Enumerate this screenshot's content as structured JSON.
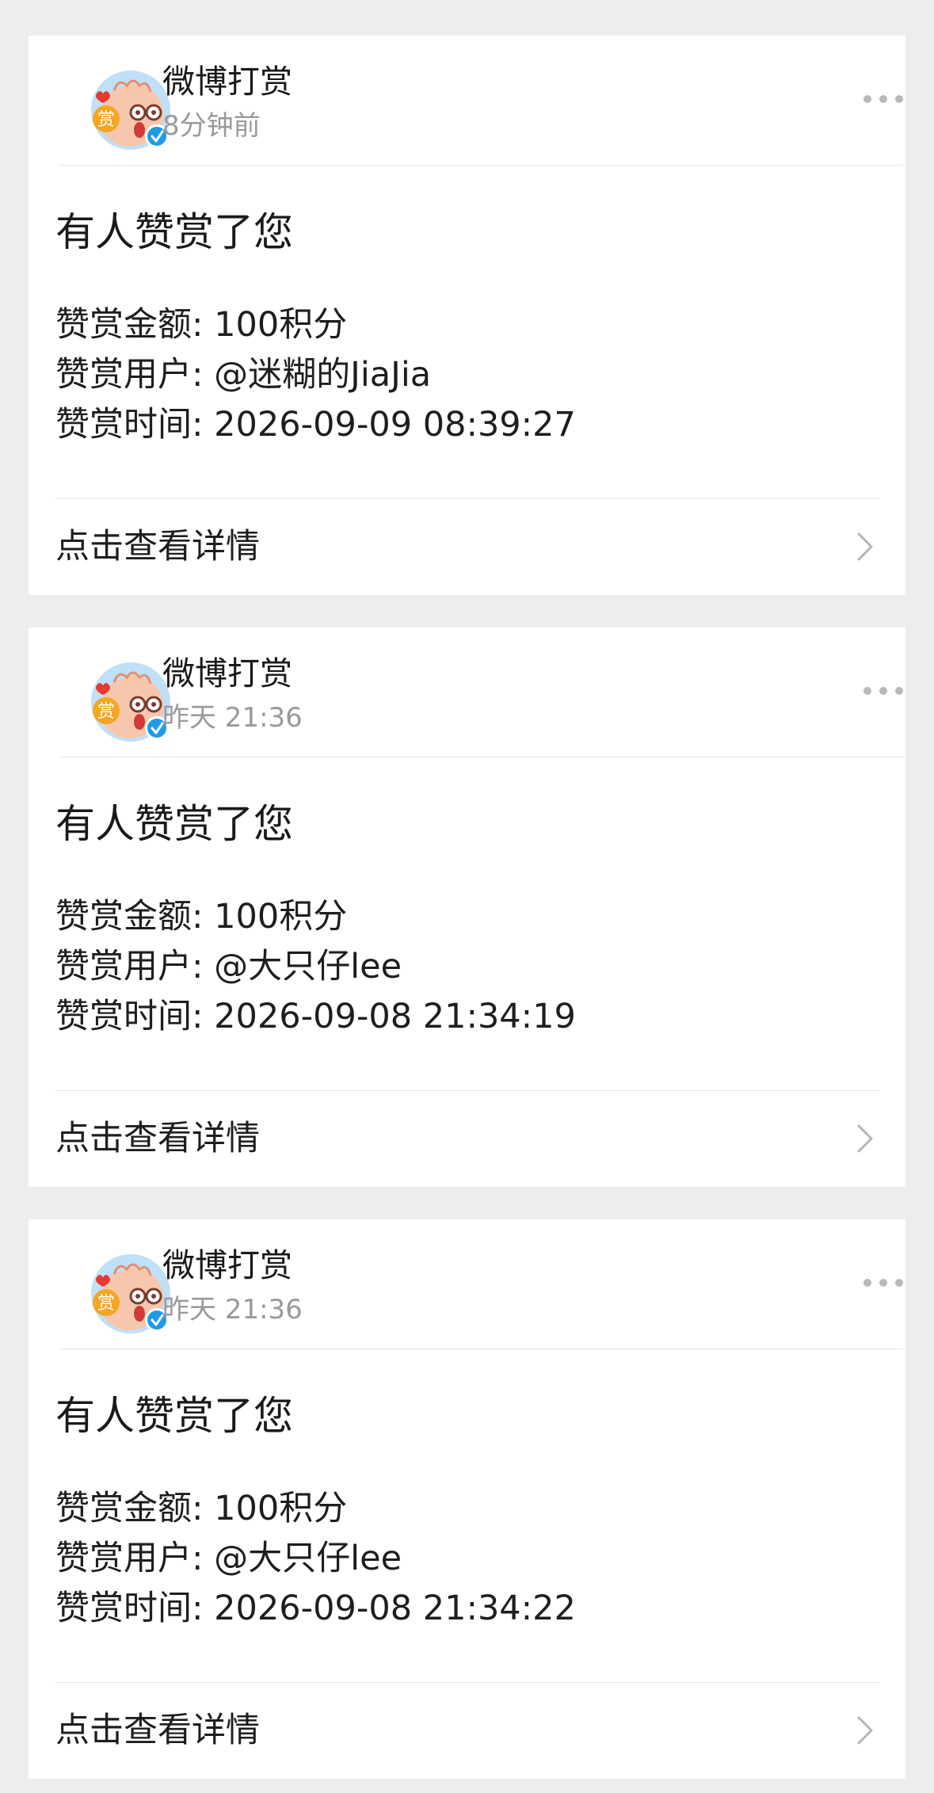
{
  "notifications": [
    {
      "sender": "微博打赏",
      "time": "8分钟前",
      "title": "有人赞赏了您",
      "amount_label": "赞赏金额:",
      "amount_value": "100积分",
      "user_label": "赞赏用户:",
      "user_value": "@迷糊的JiaJia",
      "time_label": "赞赏时间:",
      "time_value": "2026-09-09 08:39:27",
      "detail_label": "点击查看详情"
    },
    {
      "sender": "微博打赏",
      "time": "昨天 21:36",
      "title": "有人赞赏了您",
      "amount_label": "赞赏金额:",
      "amount_value": "100积分",
      "user_label": "赞赏用户:",
      "user_value": "@大只仔lee",
      "time_label": "赞赏时间:",
      "time_value": "2026-09-08 21:34:19",
      "detail_label": "点击查看详情"
    },
    {
      "sender": "微博打赏",
      "time": "昨天 21:36",
      "title": "有人赞赏了您",
      "amount_label": "赞赏金额:",
      "amount_value": "100积分",
      "user_label": "赞赏用户:",
      "user_value": "@大只仔lee",
      "time_label": "赞赏时间:",
      "time_value": "2026-09-08 21:34:22",
      "detail_label": "点击查看详情"
    }
  ],
  "avatar_badge_text": "赏",
  "icons": {
    "avatar": "weibo-reward-mascot-avatar",
    "verified": "verified-badge-icon",
    "more": "more-dots-icon",
    "chevron": "chevron-right-icon"
  },
  "colors": {
    "page_background": "#ededed",
    "card_background": "#ffffff",
    "secondary_text": "#9a9a9a",
    "verified_blue": "#1e9be8",
    "badge_orange": "#f5a623"
  }
}
